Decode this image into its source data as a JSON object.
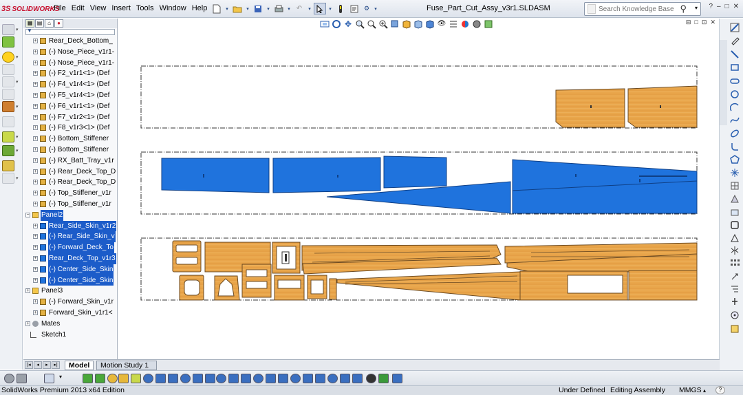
{
  "app": {
    "logo_text": "SOLIDWORKS",
    "logo_mark": "3S",
    "document_title": "Fuse_Part_Cut_Assy_v3r1.SLDASM"
  },
  "menu": [
    "File",
    "Edit",
    "View",
    "Insert",
    "Tools",
    "Window",
    "Help"
  ],
  "menu_pin": "⇱",
  "search": {
    "placeholder": "Search Knowledge Base"
  },
  "window_controls": {
    "help": "?",
    "minimize": "–",
    "restore": "□",
    "close": "✕"
  },
  "view_window_controls": [
    "⊟",
    "□",
    "⊡",
    "✕"
  ],
  "feature_tree": {
    "items": [
      {
        "label": "Rear_Deck_Bottom_",
        "type": "part"
      },
      {
        "label": "(-) Nose_Piece_v1r1-",
        "type": "part"
      },
      {
        "label": "(-) Nose_Piece_v1r1-",
        "type": "part"
      },
      {
        "label": "(-) F2_v1r1<1> (Def",
        "type": "part"
      },
      {
        "label": "(-) F4_v1r4<1> (Def",
        "type": "part"
      },
      {
        "label": "(-) F5_v1r4<1> (Def",
        "type": "part"
      },
      {
        "label": "(-) F6_v1r1<1> (Def",
        "type": "part"
      },
      {
        "label": "(-) F7_v1r2<1> (Def",
        "type": "part"
      },
      {
        "label": "(-) F8_v1r3<1> (Def",
        "type": "part"
      },
      {
        "label": "(-) Bottom_Stiffener",
        "type": "part"
      },
      {
        "label": "(-) Bottom_Stiffener",
        "type": "part"
      },
      {
        "label": "(-) RX_Batt_Tray_v1r",
        "type": "part"
      },
      {
        "label": "(-) Rear_Deck_Top_D",
        "type": "part"
      },
      {
        "label": "(-) Rear_Deck_Top_D",
        "type": "part"
      },
      {
        "label": "(-) Top_Stiffener_v1r",
        "type": "part"
      },
      {
        "label": "(-) Top_Stiffener_v1r",
        "type": "part"
      },
      {
        "label": "Panel2",
        "type": "folder-open",
        "selected": true
      },
      {
        "label": "Rear_Side_Skin_v1r2",
        "type": "part-blue",
        "selected": true
      },
      {
        "label": "(-) Rear_Side_Skin_v",
        "type": "part-blue",
        "selected": true
      },
      {
        "label": "(-) Forward_Deck_To",
        "type": "part-blue",
        "selected": true
      },
      {
        "label": "Rear_Deck_Top_v1r3",
        "type": "part-blue",
        "selected": true
      },
      {
        "label": "(-) Center_Side_Skin",
        "type": "part-blue",
        "selected": true
      },
      {
        "label": "(-) Center_Side_Skin",
        "type": "part-blue",
        "selected": true
      },
      {
        "label": "Panel3",
        "type": "folder"
      },
      {
        "label": "(-) Forward_Skin_v1r",
        "type": "part"
      },
      {
        "label": "Forward_Skin_v1r1<",
        "type": "part"
      },
      {
        "label": "Mates",
        "type": "mates"
      },
      {
        "label": "Sketch1",
        "type": "sketch"
      }
    ]
  },
  "bottom_tabs": {
    "model": "Model",
    "motion": "Motion Study 1"
  },
  "nav_buttons": [
    "|◂",
    "◂",
    "▸",
    "▸|"
  ],
  "status": {
    "edition": "SolidWorks Premium 2013 x64 Edition",
    "definition": "Under Defined",
    "mode": "Editing Assembly",
    "units": "MMGS",
    "help": "?"
  },
  "colors": {
    "selection_blue": "#1c5cc9",
    "part_blue": "#1f73dd",
    "wood": "#e8a348",
    "wood_edge": "#6b4a22"
  }
}
